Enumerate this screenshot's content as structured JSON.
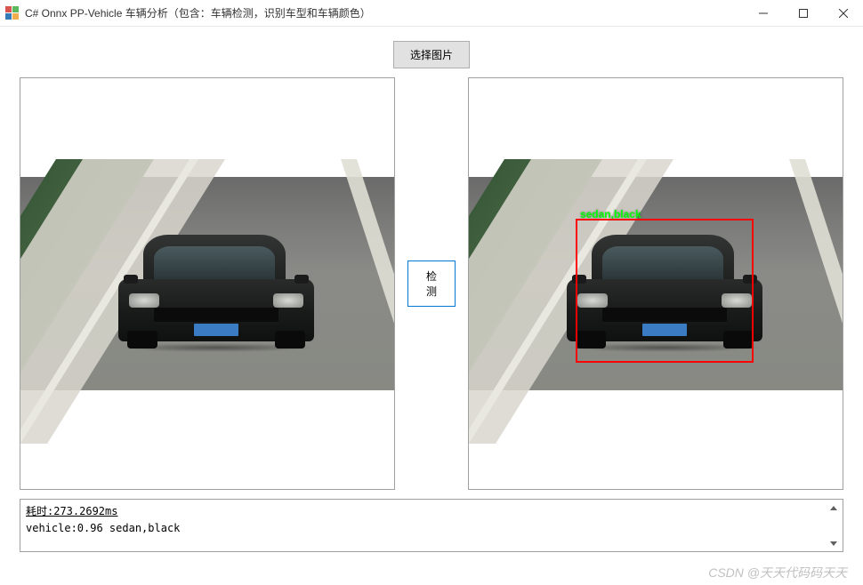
{
  "window": {
    "title": "C# Onnx PP-Vehicle 车辆分析（包含：车辆检测，识别车型和车辆颜色）"
  },
  "buttons": {
    "select_image": "选择图片",
    "detect": "检测"
  },
  "detection": {
    "label": "sedan,black",
    "box_color": "#ff0000",
    "label_color": "#00ff00"
  },
  "output": {
    "line1": "耗时:273.2692ms",
    "line2": "vehicle:0.96 sedan,black"
  },
  "watermark": "CSDN @天天代码码天天"
}
